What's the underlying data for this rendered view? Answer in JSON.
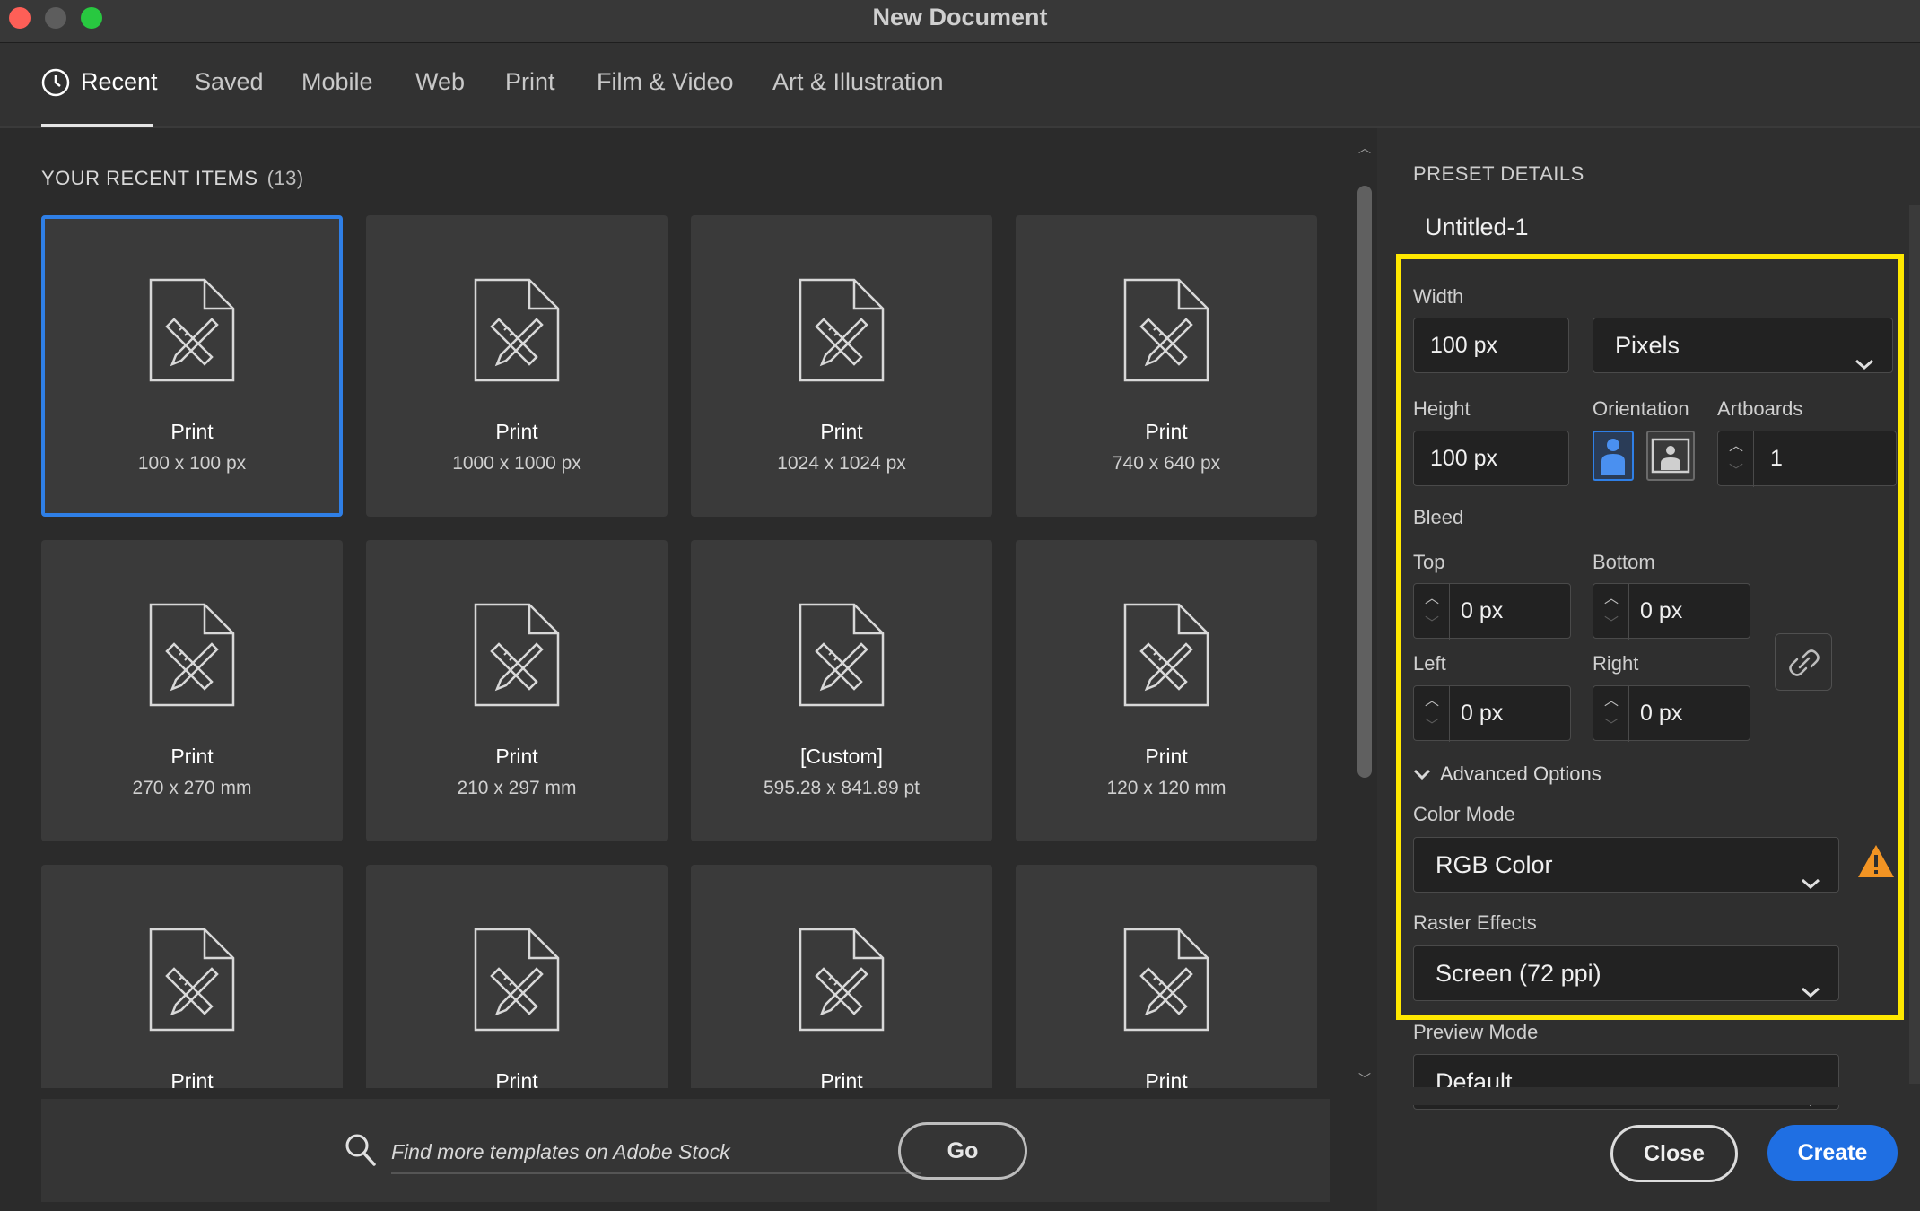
{
  "window": {
    "title": "New Document"
  },
  "tabs": [
    {
      "label": "Recent",
      "active": true
    },
    {
      "label": "Saved"
    },
    {
      "label": "Mobile"
    },
    {
      "label": "Web"
    },
    {
      "label": "Print"
    },
    {
      "label": "Film & Video"
    },
    {
      "label": "Art & Illustration"
    }
  ],
  "recent": {
    "heading": "YOUR RECENT ITEMS",
    "count": "(13)",
    "items": [
      {
        "name": "Print",
        "size": "100 x 100 px",
        "selected": true
      },
      {
        "name": "Print",
        "size": "1000 x 1000 px"
      },
      {
        "name": "Print",
        "size": "1024 x 1024 px"
      },
      {
        "name": "Print",
        "size": "740 x 640 px"
      },
      {
        "name": "Print",
        "size": "270 x 270 mm"
      },
      {
        "name": "Print",
        "size": "210 x 297 mm"
      },
      {
        "name": "[Custom]",
        "size": "595.28 x 841.89 pt"
      },
      {
        "name": "Print",
        "size": "120 x 120 mm"
      },
      {
        "name": "Print",
        "size": ""
      },
      {
        "name": "Print",
        "size": ""
      },
      {
        "name": "Print",
        "size": ""
      },
      {
        "name": "Print",
        "size": ""
      }
    ]
  },
  "search": {
    "placeholder": "Find more templates on Adobe Stock",
    "go_label": "Go"
  },
  "preset": {
    "heading": "PRESET DETAILS",
    "name": "Untitled-1",
    "width_label": "Width",
    "width_value": "100 px",
    "units_value": "Pixels",
    "height_label": "Height",
    "height_value": "100 px",
    "orientation_label": "Orientation",
    "artboards_label": "Artboards",
    "artboards_value": "1",
    "bleed_label": "Bleed",
    "top_label": "Top",
    "top_value": "0 px",
    "bottom_label": "Bottom",
    "bottom_value": "0 px",
    "left_label": "Left",
    "left_value": "0 px",
    "right_label": "Right",
    "right_value": "0 px",
    "advanced_label": "Advanced Options",
    "color_mode_label": "Color Mode",
    "color_mode_value": "RGB Color",
    "raster_label": "Raster Effects",
    "raster_value": "Screen (72 ppi)",
    "preview_label": "Preview Mode",
    "preview_value": "Default"
  },
  "actions": {
    "close_label": "Close",
    "create_label": "Create"
  },
  "colors": {
    "accent": "#1f6fe3",
    "highlight": "#ffe800",
    "warning": "#f29423"
  }
}
